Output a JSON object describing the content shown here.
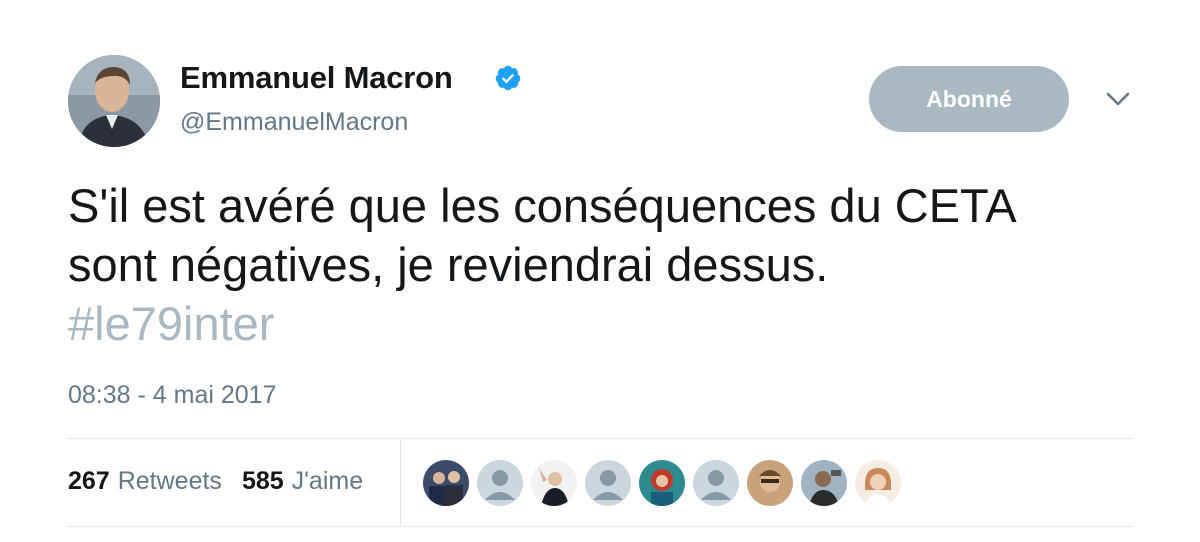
{
  "author": {
    "display_name": "Emmanuel Macron",
    "handle": "@EmmanuelMacron",
    "verified": true,
    "avatar_icon": "profile-photo"
  },
  "follow_button": {
    "label": "Abonné"
  },
  "menu_icon": "chevron-down-icon",
  "tweet": {
    "line1": "S'il est avéré que les conséquences du CETA",
    "line2": "sont négatives, je reviendrai dessus.",
    "hashtag": "#le79inter"
  },
  "timestamp": "08:38 - 4 mai 2017",
  "stats": {
    "retweets_count": "267",
    "retweets_label": "Retweets",
    "likes_count": "585",
    "likes_label": "J'aime"
  },
  "likers": [
    {
      "icon": "photo"
    },
    {
      "icon": "default-avatar"
    },
    {
      "icon": "photo"
    },
    {
      "icon": "default-avatar"
    },
    {
      "icon": "photo"
    },
    {
      "icon": "default-avatar"
    },
    {
      "icon": "photo"
    },
    {
      "icon": "photo"
    },
    {
      "icon": "photo"
    }
  ],
  "colors": {
    "button_bg": "#aab8c2",
    "verified_blue": "#1da1f2",
    "secondary_text": "#657786",
    "hashtag": "#aab8c2",
    "divider": "#e1e8ed"
  }
}
